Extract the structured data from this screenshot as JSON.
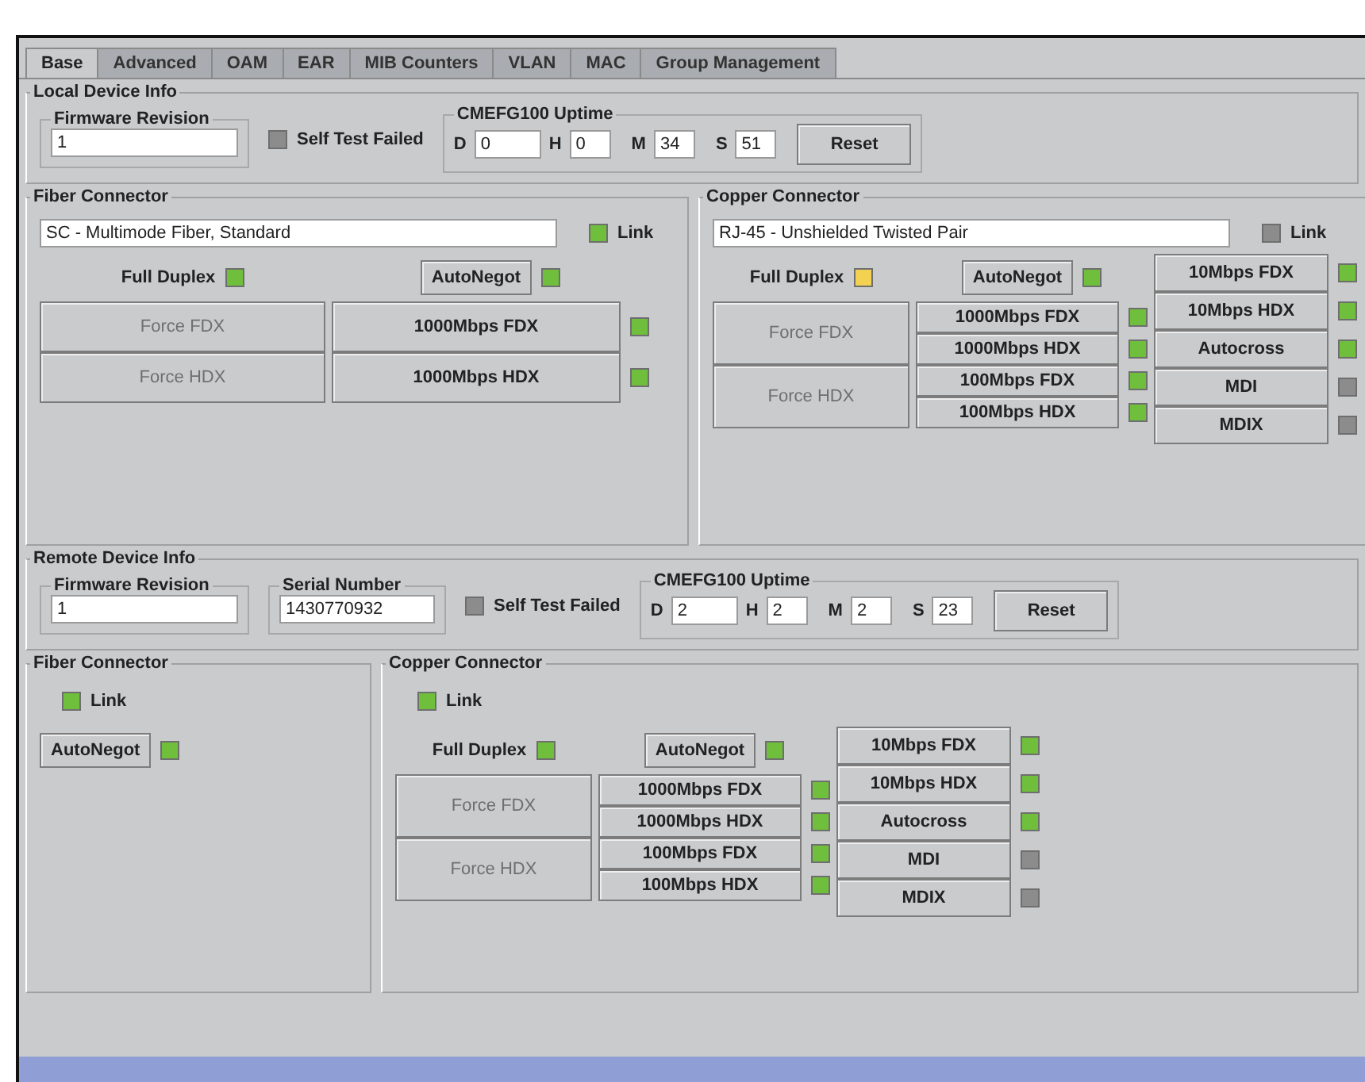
{
  "tabs": [
    {
      "label": "Base",
      "selected": true
    },
    {
      "label": "Advanced",
      "selected": false
    },
    {
      "label": "OAM",
      "selected": false
    },
    {
      "label": "EAR",
      "selected": false
    },
    {
      "label": "MIB Counters",
      "selected": false
    },
    {
      "label": "VLAN",
      "selected": false
    },
    {
      "label": "MAC",
      "selected": false
    },
    {
      "label": "Group Management",
      "selected": false
    }
  ],
  "groups": [
    {
      "info": {
        "title": "Local Device Info",
        "fields": [
          {
            "label": "Firmware Revision",
            "value": "1"
          }
        ],
        "self_test": {
          "label": "Self Test Failed",
          "color": "#8c8c8c"
        },
        "uptime": {
          "title": "CMEFG100 Uptime",
          "fields": [
            {
              "label": "D",
              "value": "0"
            },
            {
              "label": "H",
              "value": "0"
            },
            {
              "label": "M",
              "value": "34"
            },
            {
              "label": "S",
              "value": "51"
            }
          ],
          "button": "Reset"
        }
      },
      "connectors": [
        {
          "kind": "fiber",
          "title": "Fiber Connector",
          "media": "SC - Multimode Fiber, Standard",
          "link": {
            "label": "Link",
            "color": "#6fbf3c"
          },
          "full_duplex": {
            "label": "Full Duplex",
            "color": "#6fbf3c"
          },
          "autoneg": {
            "label": "AutoNegot",
            "color": "#6fbf3c"
          },
          "force": [
            {
              "label": "Force FDX",
              "disabled": true
            },
            {
              "label": "Force HDX",
              "disabled": true
            }
          ],
          "speeds": [
            {
              "label": "1000Mbps FDX",
              "color": "#6fbf3c"
            },
            {
              "label": "1000Mbps HDX",
              "color": "#6fbf3c"
            }
          ]
        },
        {
          "kind": "copper",
          "title": "Copper Connector",
          "media": "RJ-45 - Unshielded Twisted Pair",
          "link": {
            "label": "Link",
            "color": "#8c8c8c"
          },
          "full_duplex": {
            "label": "Full Duplex",
            "color": "#f2d250"
          },
          "autoneg": {
            "label": "AutoNegot",
            "color": "#6fbf3c"
          },
          "force": [
            {
              "label": "Force FDX",
              "disabled": true
            },
            {
              "label": "Force HDX",
              "disabled": true
            }
          ],
          "speeds": [
            {
              "label": "1000Mbps FDX",
              "color": "#6fbf3c"
            },
            {
              "label": "1000Mbps HDX",
              "color": "#6fbf3c"
            },
            {
              "label": "100Mbps FDX",
              "color": "#6fbf3c"
            },
            {
              "label": "100Mbps HDX",
              "color": "#6fbf3c"
            }
          ],
          "modes": [
            {
              "label": "10Mbps FDX",
              "color": "#6fbf3c"
            },
            {
              "label": "10Mbps HDX",
              "color": "#6fbf3c"
            },
            {
              "label": "Autocross",
              "color": "#6fbf3c"
            },
            {
              "label": "MDI",
              "color": "#8c8c8c"
            },
            {
              "label": "MDIX",
              "color": "#8c8c8c"
            }
          ]
        }
      ]
    },
    {
      "info": {
        "title": "Remote Device Info",
        "fields": [
          {
            "label": "Firmware Revision",
            "value": "1"
          },
          {
            "label": "Serial Number",
            "value": "1430770932"
          }
        ],
        "self_test": {
          "label": "Self Test Failed",
          "color": "#8c8c8c"
        },
        "uptime": {
          "title": "CMEFG100 Uptime",
          "fields": [
            {
              "label": "D",
              "value": "2"
            },
            {
              "label": "H",
              "value": "2"
            },
            {
              "label": "M",
              "value": "2"
            },
            {
              "label": "S",
              "value": "23"
            }
          ],
          "button": "Reset"
        }
      },
      "connectors": [
        {
          "kind": "fiber",
          "title": "Fiber Connector",
          "link": {
            "label": "Link",
            "color": "#6fbf3c"
          },
          "autoneg": {
            "label": "AutoNegot",
            "color": "#6fbf3c"
          }
        },
        {
          "kind": "copper",
          "title": "Copper Connector",
          "link": {
            "label": "Link",
            "color": "#6fbf3c"
          },
          "full_duplex": {
            "label": "Full Duplex",
            "color": "#6fbf3c"
          },
          "autoneg": {
            "label": "AutoNegot",
            "color": "#6fbf3c"
          },
          "force": [
            {
              "label": "Force FDX",
              "disabled": true
            },
            {
              "label": "Force HDX",
              "disabled": true
            }
          ],
          "speeds": [
            {
              "label": "1000Mbps FDX",
              "color": "#6fbf3c"
            },
            {
              "label": "1000Mbps HDX",
              "color": "#6fbf3c"
            },
            {
              "label": "100Mbps FDX",
              "color": "#6fbf3c"
            },
            {
              "label": "100Mbps HDX",
              "color": "#6fbf3c"
            }
          ],
          "modes": [
            {
              "label": "10Mbps FDX",
              "color": "#6fbf3c"
            },
            {
              "label": "10Mbps HDX",
              "color": "#6fbf3c"
            },
            {
              "label": "Autocross",
              "color": "#6fbf3c"
            },
            {
              "label": "MDI",
              "color": "#8c8c8c"
            },
            {
              "label": "MDIX",
              "color": "#8c8c8c"
            }
          ]
        }
      ]
    }
  ]
}
